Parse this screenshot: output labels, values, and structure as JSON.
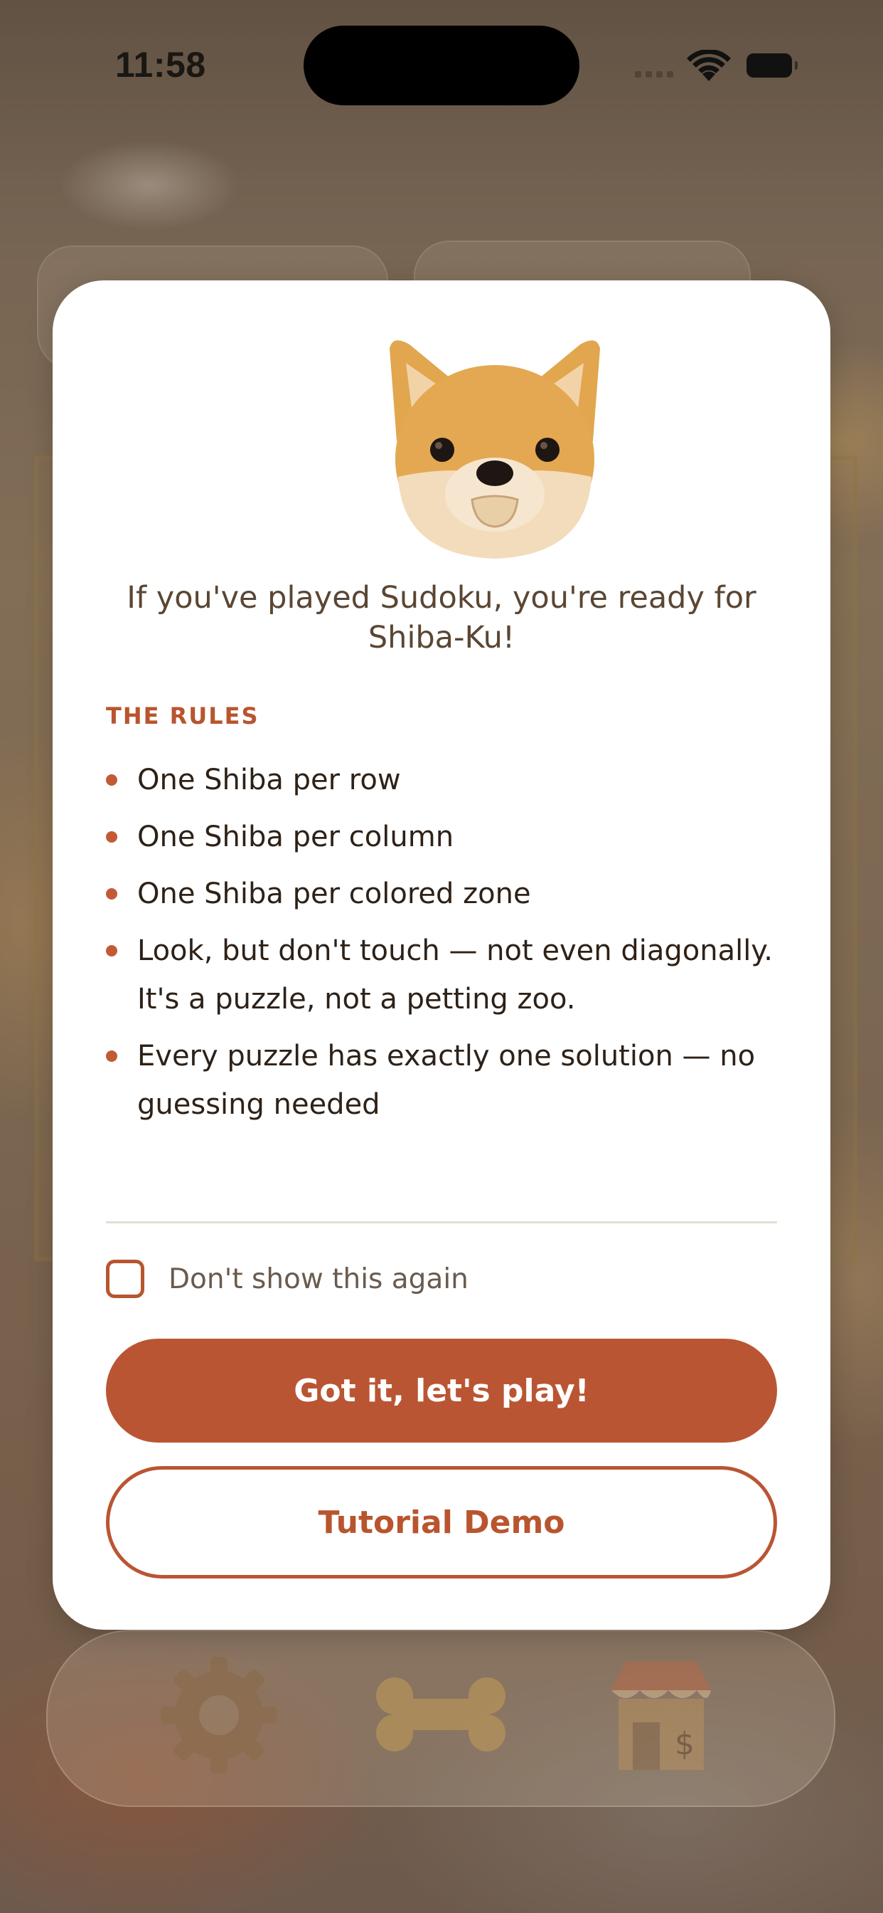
{
  "status_bar": {
    "time": "11:58"
  },
  "modal": {
    "mascot_icon": "shiba-head-icon",
    "headline": "If you've played Sudoku, you're ready for Shiba-Ku!",
    "rules_title": "THE RULES",
    "rules": [
      "One Shiba per row",
      "One Shiba per column",
      "One Shiba per colored zone",
      "Look, but don't touch — not even diagonally. It's a puzzle, not a petting zoo.",
      "Every puzzle has exactly one solution — no guessing needed"
    ],
    "dont_show_again": {
      "label": "Don't show this again",
      "checked": false
    },
    "primary_button": "Got it, let's play!",
    "secondary_button": "Tutorial Demo"
  },
  "bottom_bar": {
    "icons": [
      "gear-icon",
      "bone-icon",
      "store-icon"
    ]
  },
  "colors": {
    "accent": "#ba5533",
    "headline_text": "#5a4633",
    "body_text": "#2e2117",
    "muted_text": "#6a5b4e",
    "divider": "#e4dfd3",
    "modal_bg": "#ffffff"
  }
}
